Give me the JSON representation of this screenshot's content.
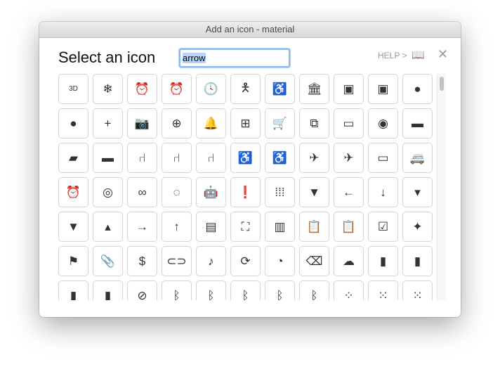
{
  "window": {
    "title": "Add an icon - material"
  },
  "header": {
    "title": "Select an icon",
    "search_value": "arrow",
    "help_label": "HELP >",
    "book_icon": "📖",
    "close_icon": "✕"
  },
  "icons": [
    {
      "name": "3d-rotation",
      "glyph": "3D"
    },
    {
      "name": "ac-unit",
      "glyph": "❄"
    },
    {
      "name": "access-alarm",
      "glyph": "⏰"
    },
    {
      "name": "access-alarms",
      "glyph": "⏰"
    },
    {
      "name": "access-time",
      "glyph": "🕓"
    },
    {
      "name": "accessibility",
      "glyph": "🯅"
    },
    {
      "name": "accessible",
      "glyph": "♿"
    },
    {
      "name": "account-balance",
      "glyph": "🏛"
    },
    {
      "name": "account-balance-wallet",
      "glyph": "▣"
    },
    {
      "name": "account-box",
      "glyph": "▣"
    },
    {
      "name": "account-circle",
      "glyph": "●"
    },
    {
      "name": "adb",
      "glyph": "●"
    },
    {
      "name": "add",
      "glyph": "+"
    },
    {
      "name": "add-a-photo",
      "glyph": "📷"
    },
    {
      "name": "add-alarm",
      "glyph": "⊕"
    },
    {
      "name": "add-alert",
      "glyph": "🔔"
    },
    {
      "name": "add-box",
      "glyph": "⊞"
    },
    {
      "name": "add-shopping-cart",
      "glyph": "🛒"
    },
    {
      "name": "add-to-photos",
      "glyph": "⧉"
    },
    {
      "name": "add-to-queue",
      "glyph": "▭"
    },
    {
      "name": "adjust",
      "glyph": "◉"
    },
    {
      "name": "airline-seat-flat",
      "glyph": "▬"
    },
    {
      "name": "airline-seat-flat-angled",
      "glyph": "▰"
    },
    {
      "name": "airline-seat-individual-suite",
      "glyph": "▬"
    },
    {
      "name": "airline-seat-legroom-extra",
      "glyph": "⑁"
    },
    {
      "name": "airline-seat-legroom-normal",
      "glyph": "⑁"
    },
    {
      "name": "airline-seat-legroom-reduced",
      "glyph": "⑁"
    },
    {
      "name": "airline-seat-recline-extra",
      "glyph": "♿"
    },
    {
      "name": "airline-seat-recline-normal",
      "glyph": "♿"
    },
    {
      "name": "airplanemode-active",
      "glyph": "✈"
    },
    {
      "name": "airplanemode-inactive",
      "glyph": "✈"
    },
    {
      "name": "airplay",
      "glyph": "▭"
    },
    {
      "name": "airport-shuttle",
      "glyph": "🚐"
    },
    {
      "name": "alarm",
      "glyph": "⏰"
    },
    {
      "name": "album",
      "glyph": "◎"
    },
    {
      "name": "all-inclusive",
      "glyph": "∞"
    },
    {
      "name": "all-out",
      "glyph": "◌"
    },
    {
      "name": "android",
      "glyph": "🤖"
    },
    {
      "name": "announcement",
      "glyph": "❗"
    },
    {
      "name": "apps",
      "glyph": "⁞⁞⁞"
    },
    {
      "name": "archive",
      "glyph": "▼"
    },
    {
      "name": "arrow-back",
      "glyph": "←"
    },
    {
      "name": "arrow-downward",
      "glyph": "↓"
    },
    {
      "name": "arrow-drop-down",
      "glyph": "▾"
    },
    {
      "name": "arrow-drop-down-circle",
      "glyph": "▼"
    },
    {
      "name": "arrow-drop-up",
      "glyph": "▴"
    },
    {
      "name": "arrow-forward",
      "glyph": "→"
    },
    {
      "name": "arrow-upward",
      "glyph": "↑"
    },
    {
      "name": "art-track",
      "glyph": "▤"
    },
    {
      "name": "aspect-ratio",
      "glyph": "⛶"
    },
    {
      "name": "assessment",
      "glyph": "▥"
    },
    {
      "name": "assignment",
      "glyph": "📋"
    },
    {
      "name": "assignment-returned",
      "glyph": "📋"
    },
    {
      "name": "assignment-turned-in",
      "glyph": "☑"
    },
    {
      "name": "assistant",
      "glyph": "✦"
    },
    {
      "name": "assistant-photo",
      "glyph": "⚑"
    },
    {
      "name": "attach-file",
      "glyph": "📎"
    },
    {
      "name": "attach-money",
      "glyph": "$"
    },
    {
      "name": "attachment",
      "glyph": "⊂⊃"
    },
    {
      "name": "audiotrack",
      "glyph": "♪"
    },
    {
      "name": "autorenew",
      "glyph": "⟳"
    },
    {
      "name": "av-timer",
      "glyph": "◔"
    },
    {
      "name": "backspace",
      "glyph": "⌫"
    },
    {
      "name": "backup",
      "glyph": "☁"
    },
    {
      "name": "battery-alert",
      "glyph": "▮"
    },
    {
      "name": "battery-charging-full",
      "glyph": "▮"
    },
    {
      "name": "battery-full",
      "glyph": "▮"
    },
    {
      "name": "battery-std",
      "glyph": "▮"
    },
    {
      "name": "battery-unknown",
      "glyph": "⊘"
    },
    {
      "name": "bluetooth",
      "glyph": "ᛒ"
    },
    {
      "name": "bluetooth-audio",
      "glyph": "ᛒ"
    },
    {
      "name": "bluetooth-connected",
      "glyph": "ᛒ"
    },
    {
      "name": "bluetooth-disabled",
      "glyph": "ᛒ"
    },
    {
      "name": "bluetooth-searching",
      "glyph": "ᛒ"
    },
    {
      "name": "blur-circular",
      "glyph": "⁘"
    },
    {
      "name": "blur-linear",
      "glyph": "⁙"
    },
    {
      "name": "blur-off",
      "glyph": "⁙"
    }
  ]
}
